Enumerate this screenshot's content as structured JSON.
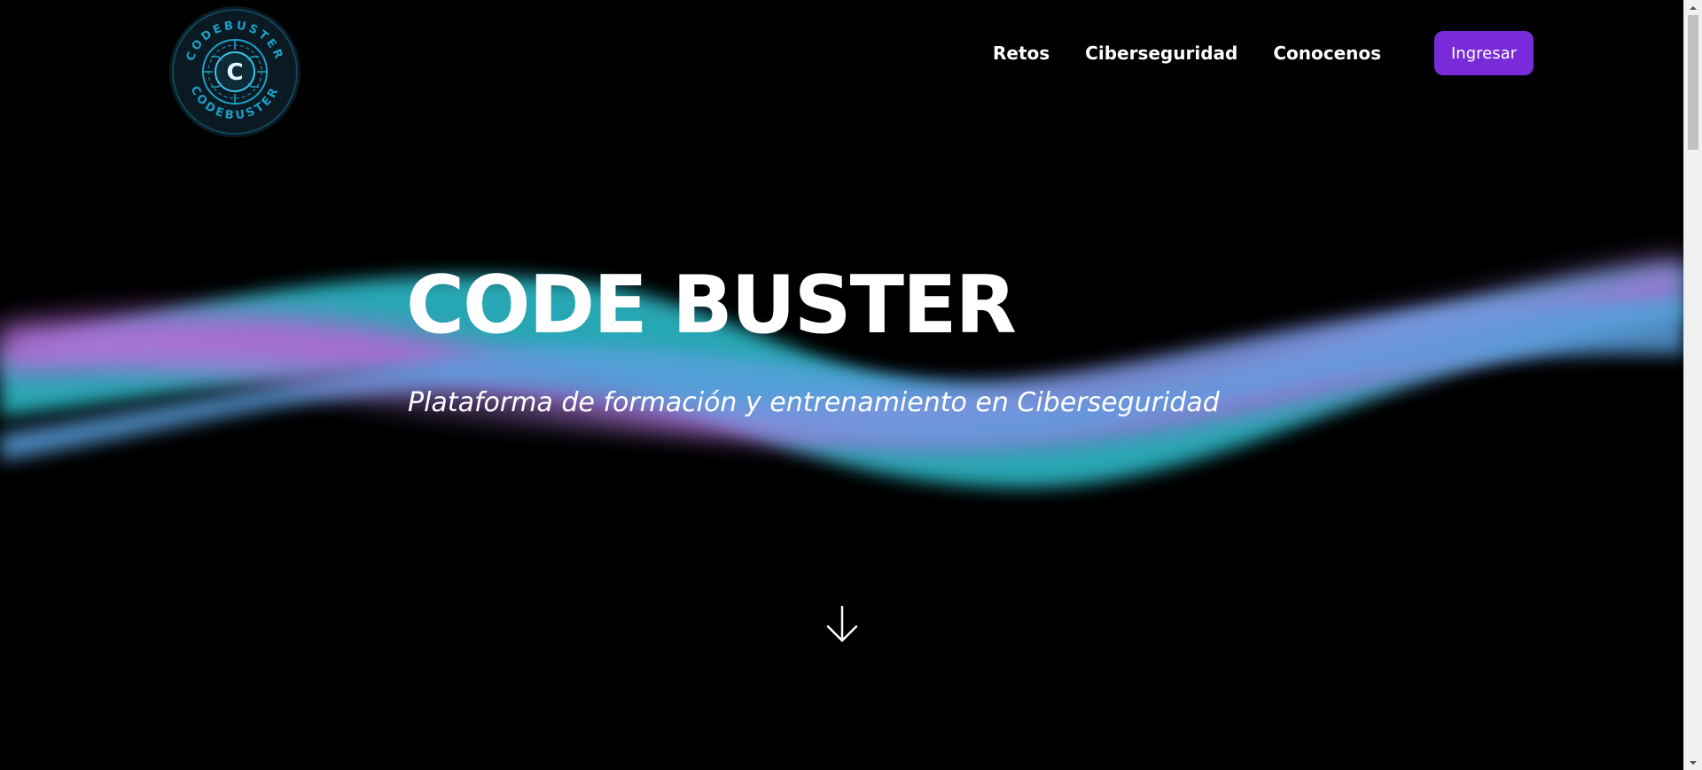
{
  "brand": {
    "logo_text": "CODEBUSTER",
    "logo_glyph": "C",
    "accent": "#7a2bd9",
    "logo_color": "#1aa0c8"
  },
  "nav": {
    "items": [
      {
        "label": "Retos"
      },
      {
        "label": "Ciberseguridad"
      },
      {
        "label": "Conocenos"
      }
    ],
    "login_label": "Ingresar"
  },
  "hero": {
    "title": "CODE BUSTER",
    "subtitle": "Plataforma de formación y entrenamiento en Ciberseguridad",
    "wave_colors": [
      "#35b7c4",
      "#c26de0",
      "#5fa8ea"
    ]
  },
  "icons": {
    "scroll": "arrow-down-icon",
    "scroll_up": "chevron-up-icon",
    "scroll_down": "chevron-down-icon"
  }
}
